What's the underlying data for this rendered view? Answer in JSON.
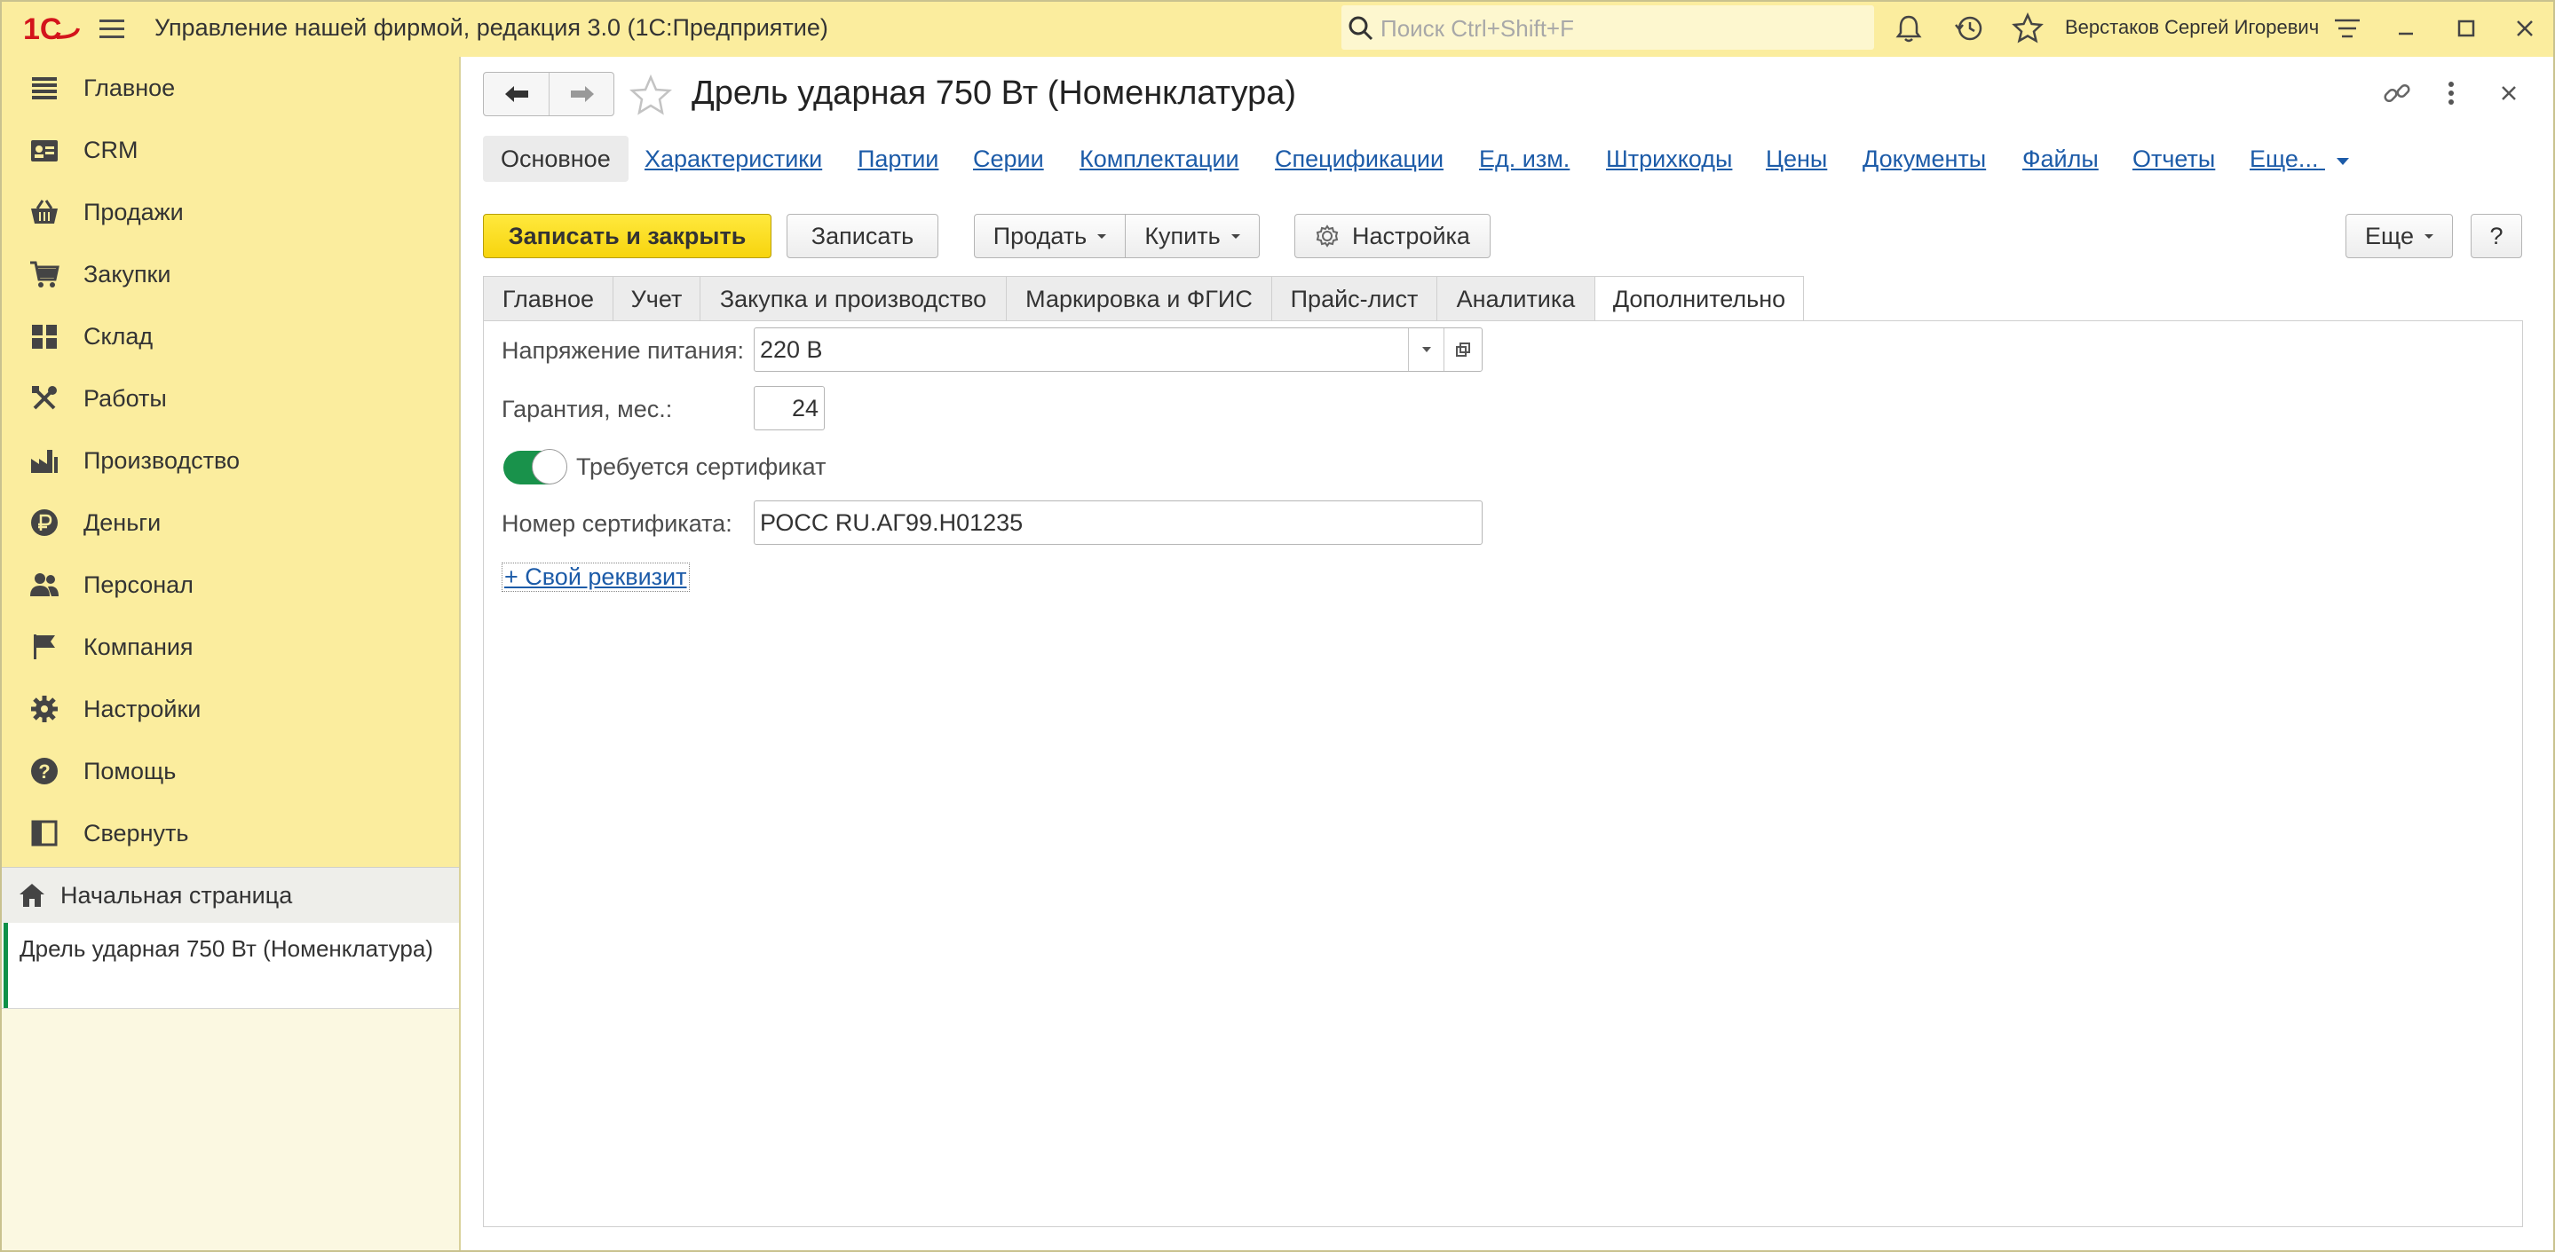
{
  "app": {
    "logo_text": "1С",
    "title": "Управление нашей фирмой, редакция 3.0  (1С:Предприятие)",
    "search_placeholder": "Поиск Ctrl+Shift+F",
    "user_name": "Верстаков Сергей Игоревич"
  },
  "sidebar": {
    "items": [
      {
        "label": "Главное",
        "icon": "menu-lines-icon"
      },
      {
        "label": "CRM",
        "icon": "contact-card-icon"
      },
      {
        "label": "Продажи",
        "icon": "basket-icon"
      },
      {
        "label": "Закупки",
        "icon": "cart-icon"
      },
      {
        "label": "Склад",
        "icon": "grid-icon"
      },
      {
        "label": "Работы",
        "icon": "tools-icon"
      },
      {
        "label": "Производство",
        "icon": "factory-icon"
      },
      {
        "label": "Деньги",
        "icon": "ruble-icon"
      },
      {
        "label": "Персонал",
        "icon": "people-icon"
      },
      {
        "label": "Компания",
        "icon": "flag-icon"
      },
      {
        "label": "Настройки",
        "icon": "gear-icon"
      },
      {
        "label": "Помощь",
        "icon": "question-icon"
      },
      {
        "label": "Свернуть",
        "icon": "collapse-icon"
      }
    ],
    "home_label": "Начальная страница",
    "open_window_label": "Дрель ударная 750 Вт (Номенклатура)"
  },
  "form": {
    "title": "Дрель ударная 750 Вт (Номенклатура)",
    "sections": [
      "Основное",
      "Характеристики",
      "Партии",
      "Серии",
      "Комплектации",
      "Спецификации",
      "Ед. изм.",
      "Штрихкоды",
      "Цены",
      "Документы",
      "Файлы",
      "Отчеты",
      "Еще..."
    ],
    "buttons": {
      "save_close": "Записать и закрыть",
      "save": "Записать",
      "sell": "Продать",
      "buy": "Купить",
      "settings": "Настройка",
      "more": "Еще",
      "help": "?"
    },
    "tabs": [
      "Главное",
      "Учет",
      "Закупка и производство",
      "Маркировка и ФГИС",
      "Прайс-лист",
      "Аналитика",
      "Дополнительно"
    ],
    "active_tab": "Дополнительно",
    "fields": {
      "voltage_label": "Напряжение питания:",
      "voltage_value": "220 В",
      "warranty_label": "Гарантия, мес.:",
      "warranty_value": "24",
      "certificate_toggle_label": "Требуется сертификат",
      "certificate_required": true,
      "cert_number_label": "Номер сертификата:",
      "cert_number_value": "РОСС RU.АГ99.Н01235"
    },
    "add_attribute_link": "+ Свой реквизит"
  },
  "colors": {
    "chrome_yellow": "#fbed9e",
    "primary_button": "#f7d40d",
    "link": "#1c5ba8",
    "toggle_on": "#19924b",
    "active_window_marker": "#0f9048"
  }
}
